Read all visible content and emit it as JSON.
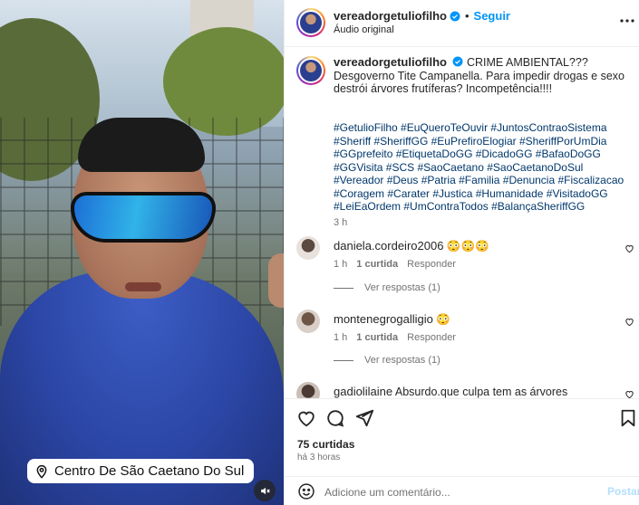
{
  "media": {
    "location": "Centro De São Caetano Do Sul",
    "icons": {
      "location": "location-pin-icon",
      "mute": "speaker-muted-icon"
    }
  },
  "header": {
    "username": "vereadorgetuliofilho",
    "separator": "•",
    "follow_label": "Seguir",
    "audio": "Áudio original"
  },
  "caption": {
    "username": "vereadorgetuliofilho",
    "text": "CRIME AMBIENTAL??? Desgoverno Tite Campanella. Para impedir drogas e sexo destrói árvores frutíferas? Incompetência!!!!",
    "hashtags": "#GetulioFilho #EuQueroTeOuvir #JuntosContraoSistema #Sheriff #SheriffGG #EuPrefiroElogiar #SheriffPorUmDia #GGprefeito #EtiquetaDoGG #DicadoGG #BafaoDoGG #GGVisita #SCS #SaoCaetano #SaoCaetanoDoSul #Vereador #Deus #Patria #Familia #Denuncia #Fiscalizacao #Coragem #Carater #Justica #Humanidade #VisitadoGG #LeiEaOrdem #UmContraTodos #BalançaSheriffGG",
    "time": "3 h"
  },
  "comments": [
    {
      "username": "daniela.cordeiro2006",
      "text": "😳😳😳",
      "time": "1 h",
      "likes": "1 curtida",
      "reply": "Responder",
      "view_replies": "Ver respostas (1)"
    },
    {
      "username": "montenegrogalligio",
      "text": "😳",
      "time": "1 h",
      "likes": "1 curtida",
      "reply": "Responder",
      "view_replies": "Ver respostas (1)"
    },
    {
      "username": "gadiolilaine",
      "text": "Absurdo.que culpa tem as árvores"
    }
  ],
  "footer": {
    "likes": "75 curtidas",
    "ago": "há 3 horas",
    "comment_placeholder": "Adicione um comentário...",
    "post_label": "Postar"
  },
  "colors": {
    "accent": "#0095f6",
    "link": "#00376b",
    "muted": "#737373"
  }
}
